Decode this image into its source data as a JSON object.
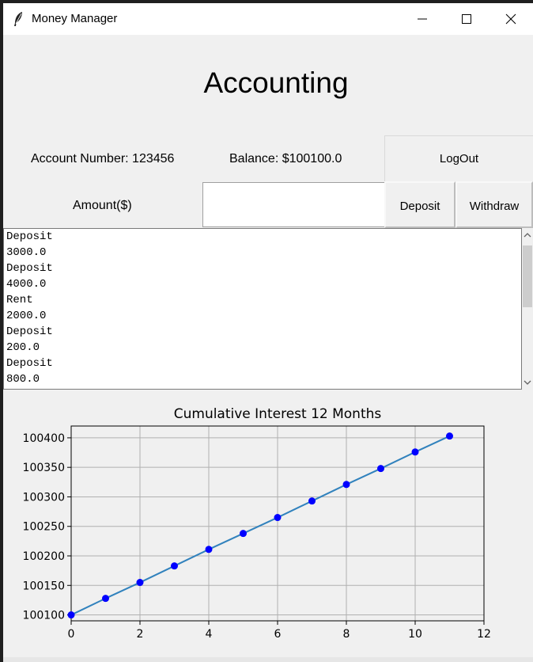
{
  "window": {
    "title": "Money Manager"
  },
  "heading": "Accounting",
  "account": {
    "number_label": "Account Number: 123456",
    "balance_label": "Balance: $100100.0"
  },
  "buttons": {
    "logout": "LogOut",
    "deposit": "Deposit",
    "withdraw": "Withdraw"
  },
  "amount": {
    "label": "Amount($)",
    "value": ""
  },
  "transactions": [
    "Deposit",
    "3000.0",
    "Deposit",
    "4000.0",
    "Rent",
    "2000.0",
    "Deposit",
    "200.0",
    "Deposit",
    "800.0"
  ],
  "chart_data": {
    "type": "line",
    "title": "Cumulative Interest 12 Months",
    "xlabel": "",
    "ylabel": "",
    "x": [
      0,
      1,
      2,
      3,
      4,
      5,
      6,
      7,
      8,
      9,
      10,
      11
    ],
    "series": [
      {
        "values": [
          100100,
          100128,
          100155,
          100183,
          100211,
          100238,
          100265,
          100293,
          100321,
          100348,
          100376,
          100403
        ]
      }
    ],
    "xlim": [
      0,
      12
    ],
    "ylim": [
      100090,
      100420
    ],
    "xticks": [
      0,
      2,
      4,
      6,
      8,
      10,
      12
    ],
    "yticks": [
      100100,
      100150,
      100200,
      100250,
      100300,
      100350,
      100400
    ],
    "grid": true,
    "line_color": "#3182bd",
    "marker_color": "#0000ff"
  }
}
